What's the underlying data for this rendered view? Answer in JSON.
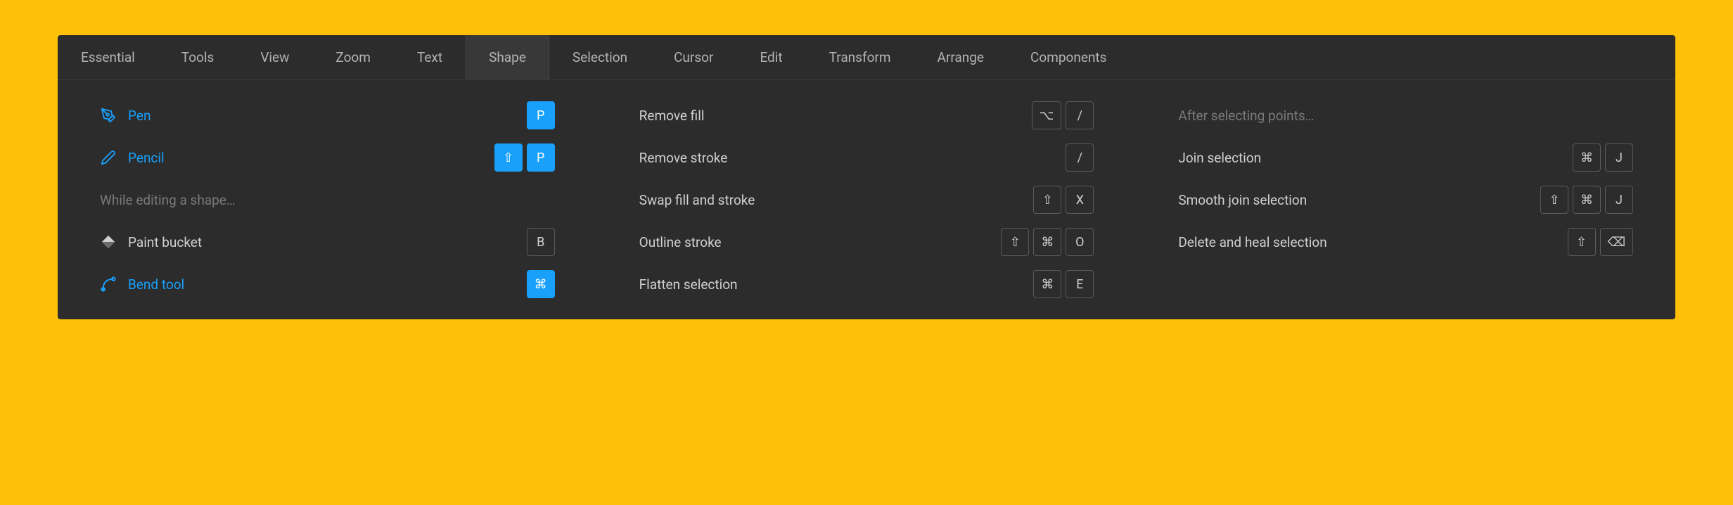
{
  "tabs": {
    "essential": "Essential",
    "tools": "Tools",
    "view": "View",
    "zoom": "Zoom",
    "text": "Text",
    "shape": "Shape",
    "selection": "Selection",
    "cursor": "Cursor",
    "edit": "Edit",
    "transform": "Transform",
    "arrange": "Arrange",
    "components": "Components"
  },
  "col1": {
    "pen": {
      "label": "Pen",
      "keys": [
        "P"
      ]
    },
    "pencil": {
      "label": "Pencil",
      "keys": [
        "⇧",
        "P"
      ]
    },
    "hint": "While editing a shape…",
    "paint_bucket": {
      "label": "Paint bucket",
      "keys": [
        "B"
      ]
    },
    "bend_tool": {
      "label": "Bend tool",
      "keys": [
        "⌘"
      ]
    }
  },
  "col2": {
    "remove_fill": {
      "label": "Remove fill",
      "keys": [
        "⌥",
        "/"
      ]
    },
    "remove_stroke": {
      "label": "Remove stroke",
      "keys": [
        "/"
      ]
    },
    "swap": {
      "label": "Swap fill and stroke",
      "keys": [
        "⇧",
        "X"
      ]
    },
    "outline": {
      "label": "Outline stroke",
      "keys": [
        "⇧",
        "⌘",
        "O"
      ]
    },
    "flatten": {
      "label": "Flatten selection",
      "keys": [
        "⌘",
        "E"
      ]
    }
  },
  "col3": {
    "hint": "After selecting points…",
    "join": {
      "label": "Join selection",
      "keys": [
        "⌘",
        "J"
      ]
    },
    "smooth_join": {
      "label": "Smooth join selection",
      "keys": [
        "⇧",
        "⌘",
        "J"
      ]
    },
    "delete_heal": {
      "label": "Delete and heal selection",
      "keys": [
        "⇧",
        "⌫"
      ]
    }
  },
  "colors": {
    "accent": "#18a0fb",
    "background": "#ffc107",
    "panel": "#2c2c2c"
  }
}
